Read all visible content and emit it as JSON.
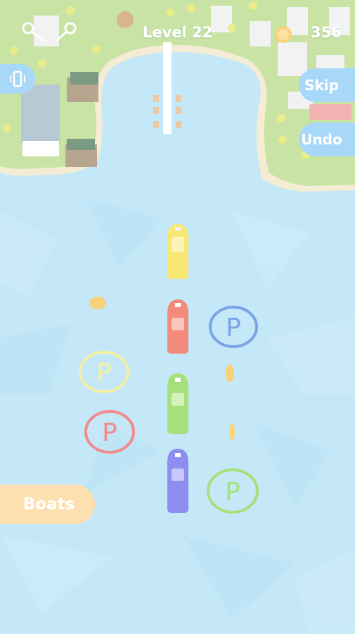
{
  "hud": {
    "level_label": "Level 22",
    "coins": "356",
    "skip_label": "Skip",
    "undo_label": "Undo",
    "boats_label": "Boats",
    "vibration_icon": "vibration-icon",
    "settings_icon": "keys-icon"
  },
  "board": {
    "parking_label": "P",
    "boats": [
      {
        "color": "yellow",
        "hex": "#f9e774"
      },
      {
        "color": "red",
        "hex": "#f28b7e"
      },
      {
        "color": "green",
        "hex": "#a5e07a"
      },
      {
        "color": "blue",
        "hex": "#8e8df0"
      }
    ],
    "parking_spots": [
      {
        "color": "blue",
        "hex": "#7aa4ea"
      },
      {
        "color": "yellow",
        "hex": "#f4f0a0"
      },
      {
        "color": "red",
        "hex": "#f28b8b"
      },
      {
        "color": "green",
        "hex": "#a5e07a"
      }
    ],
    "coins_on_water": 3
  },
  "colors": {
    "water": "#c4e8f7",
    "land": "#c8e3a4",
    "button": "#a8d8f8",
    "boats_button": "#fddfb0"
  }
}
